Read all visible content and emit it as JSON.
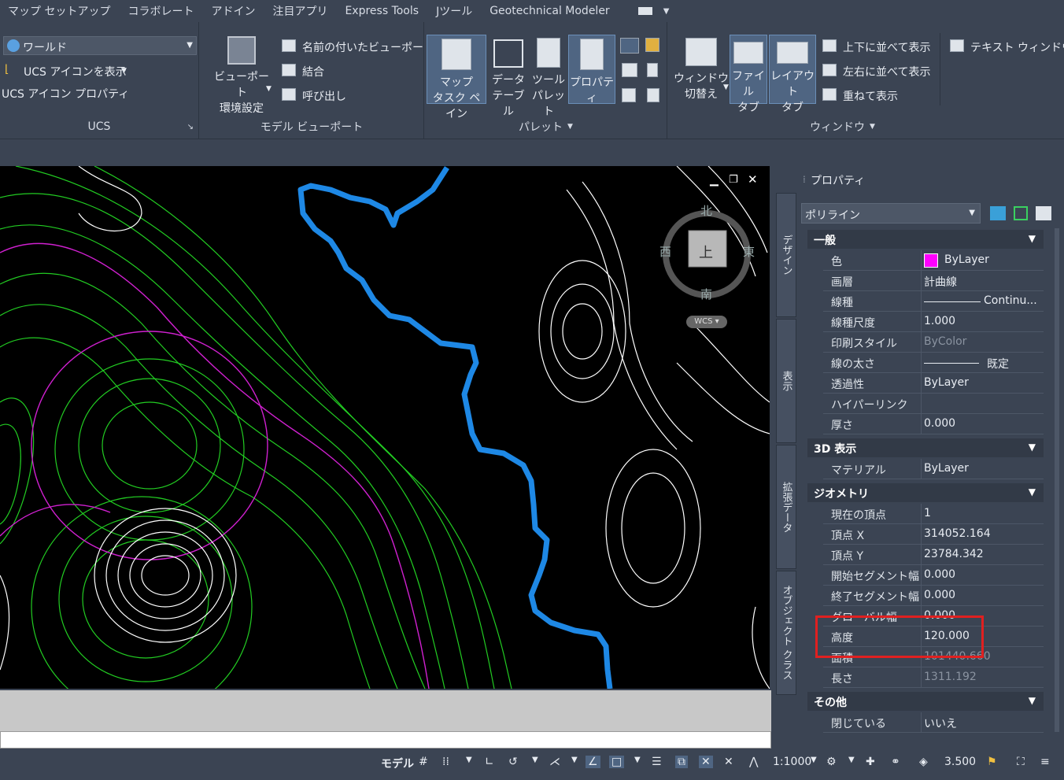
{
  "menu": [
    "マップ セットアップ",
    "コラボレート",
    "アドイン",
    "注目アプリ",
    "Express Tools",
    "Jツール",
    "Geotechnical Modeler"
  ],
  "ribbon": {
    "ucs": {
      "dropdown": "ワールド",
      "show_icon": "UCS アイコンを表示",
      "props": "UCS アイコン プロパティ",
      "footer": "UCS"
    },
    "viewport": {
      "env1": "ビューポート",
      "env2": "環境設定",
      "named": "名前の付いたビューポート",
      "join": "結合",
      "restore": "呼び出し",
      "footer": "モデル ビューポート"
    },
    "palette": {
      "map1": "マップ",
      "map2": "タスク ペイン",
      "data1": "データ",
      "data2": "テーブル",
      "tool1": "ツール",
      "tool2": "パレット",
      "props": "プロパティ",
      "footer": "パレット"
    },
    "window": {
      "sw1": "ウィンドウ",
      "sw2": "切替え",
      "file1": "ファイル",
      "file2": "タブ",
      "layout1": "レイアウト",
      "layout2": "タブ",
      "stack": "上下に並べて表示",
      "tile": "左右に並べて表示",
      "cascade": "重ねて表示",
      "text": "テキスト ウィンドウ",
      "footer": "ウィンドウ"
    }
  },
  "viewcube": {
    "north": "北",
    "south": "南",
    "east": "東",
    "west": "西",
    "top": "上",
    "wcs": "WCS"
  },
  "properties": {
    "title": "プロパティ",
    "object": "ポリライン",
    "tabs": [
      "デザイン",
      "表示",
      "拡張データ",
      "オブジェクト クラス"
    ],
    "general": {
      "header": "一般",
      "rows": [
        [
          "色",
          "ByLayer"
        ],
        [
          "画層",
          "計曲線"
        ],
        [
          "線種",
          "Continu..."
        ],
        [
          "線種尺度",
          "1.000"
        ],
        [
          "印刷スタイル",
          "ByColor"
        ],
        [
          "線の太さ",
          "既定"
        ],
        [
          "透過性",
          "ByLayer"
        ],
        [
          "ハイパーリンク",
          ""
        ],
        [
          "厚さ",
          "0.000"
        ]
      ]
    },
    "d3": {
      "header": "3D 表示",
      "rows": [
        [
          "マテリアル",
          "ByLayer"
        ]
      ]
    },
    "geometry": {
      "header": "ジオメトリ",
      "rows": [
        [
          "現在の頂点",
          "1"
        ],
        [
          "頂点 X",
          "314052.164"
        ],
        [
          "頂点 Y",
          "23784.342"
        ],
        [
          "開始セグメント幅",
          "0.000"
        ],
        [
          "終了セグメント幅",
          "0.000"
        ],
        [
          "グローバル幅",
          "0.000"
        ],
        [
          "高度",
          "120.000"
        ],
        [
          "面積",
          "101440.660"
        ],
        [
          "長さ",
          "1311.192"
        ]
      ]
    },
    "other": {
      "header": "その他",
      "rows": [
        [
          "閉じている",
          "いいえ"
        ]
      ]
    },
    "color_swatch": "#ff00ff",
    "highlight_color": "#e02020"
  },
  "status": {
    "model": "モデル",
    "scale": "1:1000",
    "value": "3.500"
  }
}
